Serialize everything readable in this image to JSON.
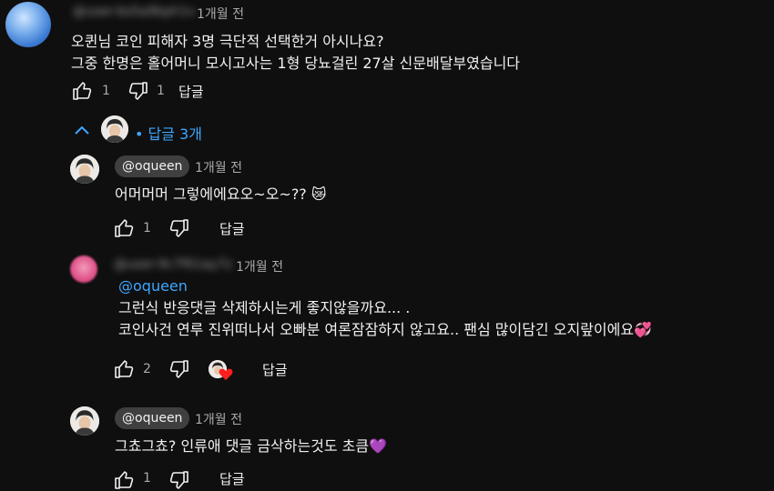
{
  "comment1": {
    "author": "@user-bs5a9kph1v",
    "time": "1개월 전",
    "lines": [
      "오퀸님 코인 피해자 3명 극단적 선택한거 아시나요?",
      "그중 한명은 홀어머니 모시고사는 1형 당뇨걸린 27살 신문배달부였습니다"
    ],
    "likes": "1",
    "dislikes": "1",
    "reply_label": "답글"
  },
  "replies_toggle": {
    "label": "답글 3개",
    "dot": "•"
  },
  "reply1": {
    "author": "@oqueen",
    "time": "1개월 전",
    "text": "어머머머 그렇에에요오~오~?? 😿",
    "likes": "1",
    "reply_label": "답글"
  },
  "reply2": {
    "author": "@user-9c7f61ay7z",
    "time": "1개월 전",
    "mention": "@oqueen",
    "lines": [
      "그런식 반응댓글 삭제하시는게 좋지않을까요... .",
      "코인사건 연루 진위떠나서 오빠분 여론잠잠하지 않고요..  팬심 많이담긴 오지랖이에요💞"
    ],
    "likes": "2",
    "reply_label": "답글"
  },
  "reply3": {
    "author": "@oqueen",
    "time": "1개월 전",
    "text": "그쵸그쵸? 인류애 댓글 금삭하는것도 초큼💜",
    "likes": "1",
    "reply_label": "답글"
  },
  "colors": {
    "background": "#0f0f0f",
    "link": "#3ea6ff",
    "chip": "#3f3f3f",
    "secondary_text": "#aaaaaa"
  }
}
